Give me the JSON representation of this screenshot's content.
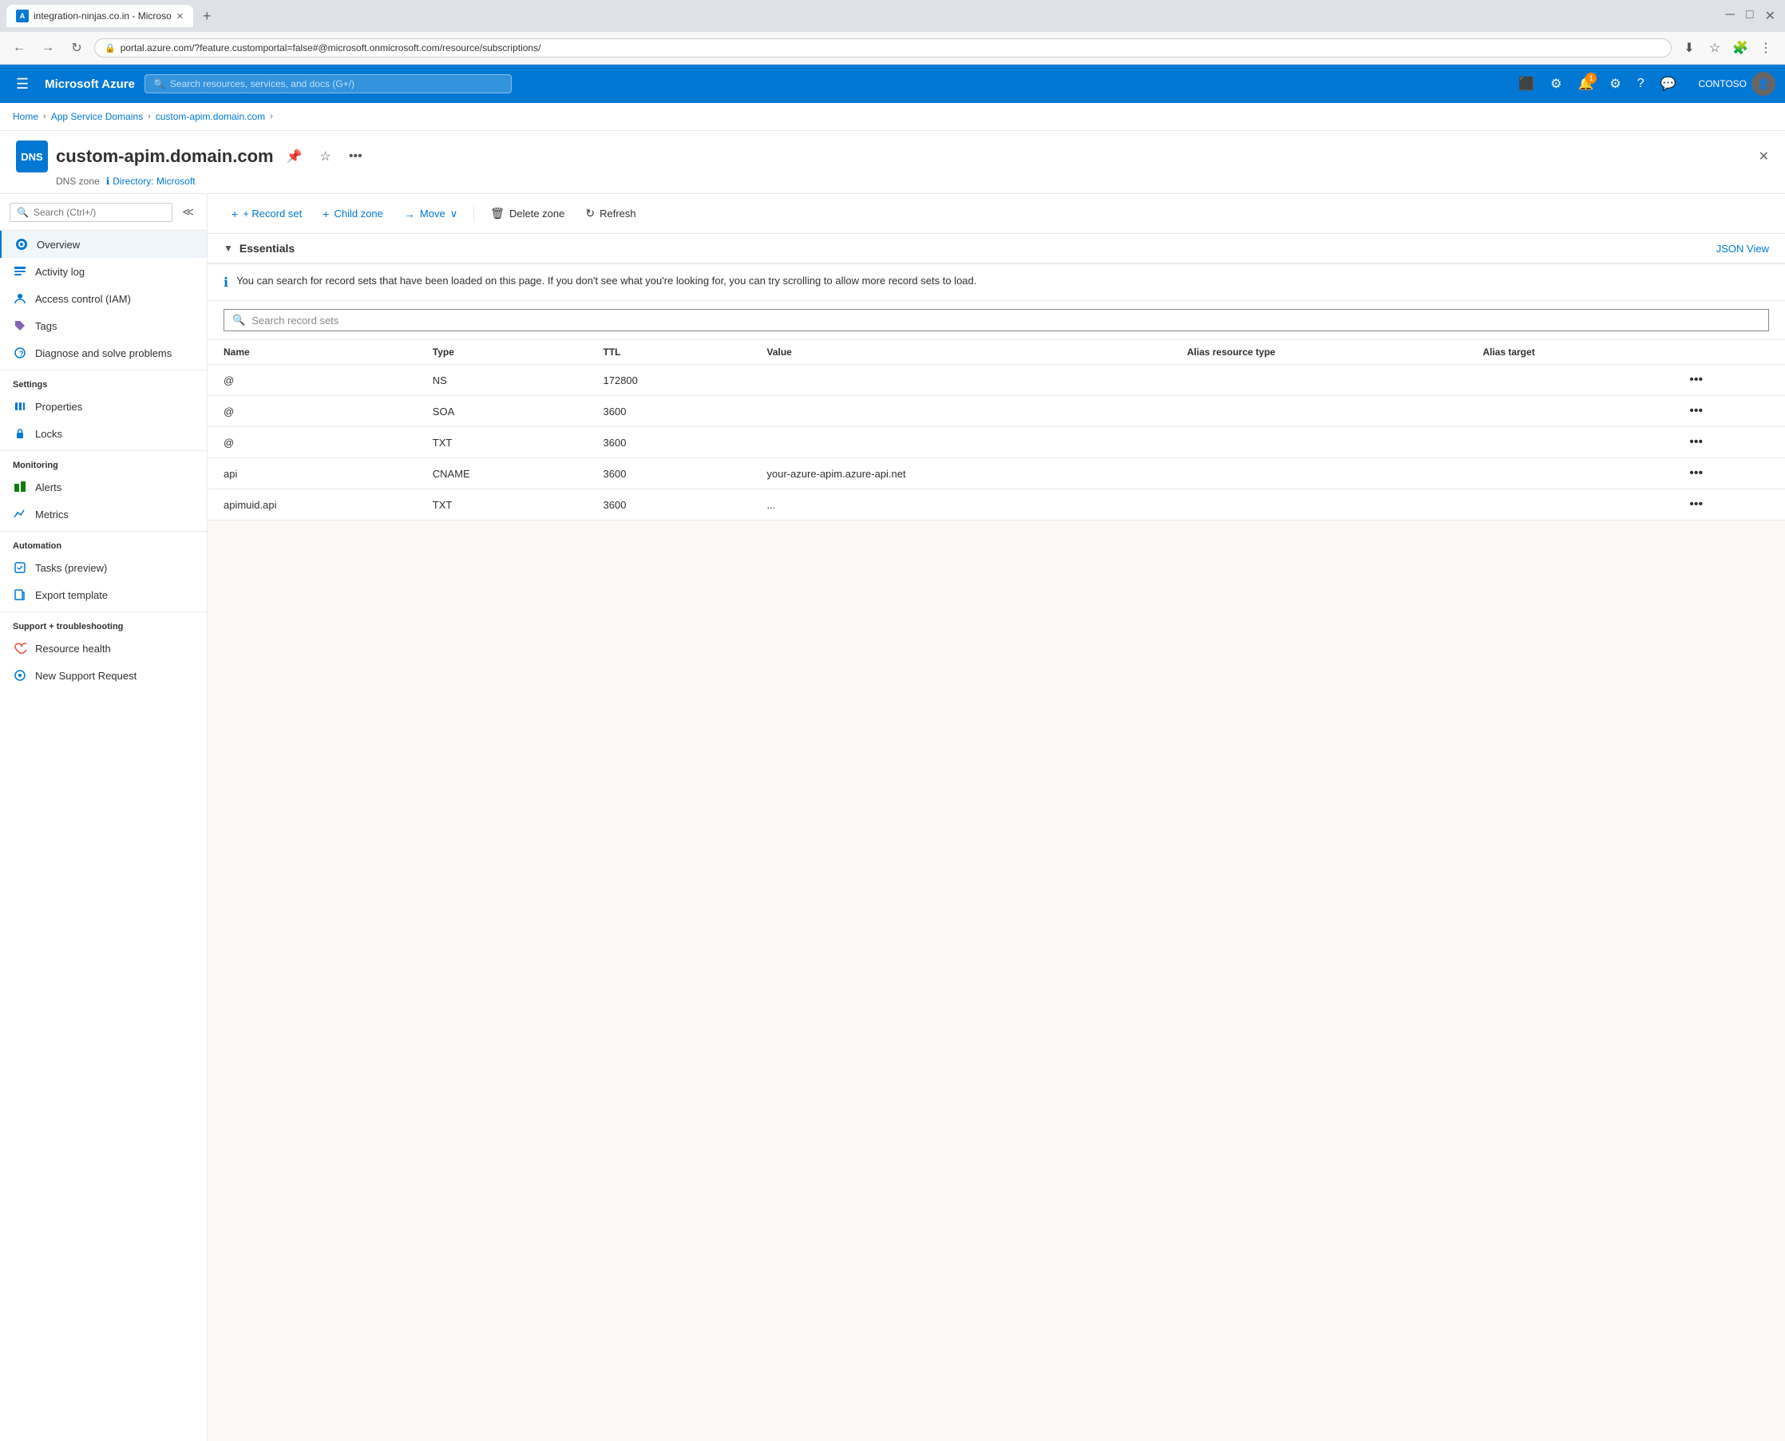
{
  "browser": {
    "tab_title": "integration-ninjas.co.in - Microso",
    "tab_favicon": "A",
    "url": "portal.azure.com/?feature.customportal=false#@microsoft.onmicrosoft.com/resource/subscriptions/",
    "new_tab_label": "+"
  },
  "azure_nav": {
    "hamburger_label": "☰",
    "logo": "Microsoft Azure",
    "search_placeholder": "Search resources, services, and docs (G+/)",
    "notification_count": "1",
    "account_name": "CONTOSO"
  },
  "breadcrumb": {
    "home": "Home",
    "app_service_domains": "App Service Domains",
    "current": "custom-apim.domain.com"
  },
  "resource": {
    "icon_label": "DNS",
    "title": "custom-apim.domain.com",
    "subtitle_type": "DNS zone",
    "subtitle_directory": "Directory: Microsoft"
  },
  "sidebar": {
    "search_placeholder": "Search (Ctrl+/)",
    "items": [
      {
        "id": "overview",
        "label": "Overview",
        "active": true
      },
      {
        "id": "activity-log",
        "label": "Activity log"
      },
      {
        "id": "access-control",
        "label": "Access control (IAM)"
      },
      {
        "id": "tags",
        "label": "Tags"
      },
      {
        "id": "diagnose",
        "label": "Diagnose and solve problems"
      }
    ],
    "sections": [
      {
        "title": "Settings",
        "items": [
          {
            "id": "properties",
            "label": "Properties"
          },
          {
            "id": "locks",
            "label": "Locks"
          }
        ]
      },
      {
        "title": "Monitoring",
        "items": [
          {
            "id": "alerts",
            "label": "Alerts"
          },
          {
            "id": "metrics",
            "label": "Metrics"
          }
        ]
      },
      {
        "title": "Automation",
        "items": [
          {
            "id": "tasks",
            "label": "Tasks (preview)"
          },
          {
            "id": "export-template",
            "label": "Export template"
          }
        ]
      },
      {
        "title": "Support + troubleshooting",
        "items": [
          {
            "id": "resource-health",
            "label": "Resource health"
          },
          {
            "id": "new-support",
            "label": "New Support Request"
          }
        ]
      }
    ]
  },
  "toolbar": {
    "record_set_label": "+ Record set",
    "child_zone_label": "+ Child zone",
    "move_label": "→ Move",
    "delete_zone_label": "Delete zone",
    "refresh_label": "Refresh"
  },
  "essentials": {
    "title": "Essentials",
    "json_view_label": "JSON View"
  },
  "info_banner": {
    "text": "You can search for record sets that have been loaded on this page. If you don't see what you're looking for, you can try scrolling to allow more record sets to load."
  },
  "search_records": {
    "placeholder": "Search record sets"
  },
  "table": {
    "headers": [
      "Name",
      "Type",
      "TTL",
      "Value",
      "Alias resource type",
      "Alias target"
    ],
    "rows": [
      {
        "name": "@",
        "type": "NS",
        "ttl": "172800",
        "value": "",
        "alias_resource_type": "",
        "alias_target": ""
      },
      {
        "name": "@",
        "type": "SOA",
        "ttl": "3600",
        "value": "",
        "alias_resource_type": "",
        "alias_target": ""
      },
      {
        "name": "@",
        "type": "TXT",
        "ttl": "3600",
        "value": "",
        "alias_resource_type": "",
        "alias_target": ""
      },
      {
        "name": "api",
        "type": "CNAME",
        "ttl": "3600",
        "value": "your-azure-apim.azure-api.net",
        "alias_resource_type": "",
        "alias_target": ""
      },
      {
        "name": "apimuid.api",
        "type": "TXT",
        "ttl": "3600",
        "value": "...",
        "alias_resource_type": "",
        "alias_target": ""
      }
    ]
  }
}
